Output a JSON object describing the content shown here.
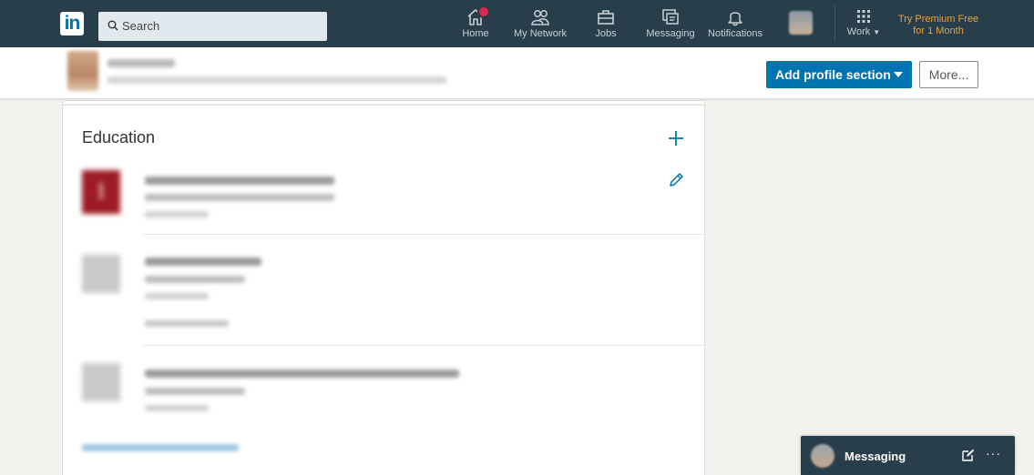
{
  "topbar": {
    "logo_text": "in",
    "search_placeholder": "Search",
    "nav": [
      {
        "label": "Home",
        "icon": "home-icon",
        "has_badge": true
      },
      {
        "label": "My Network",
        "icon": "network-icon"
      },
      {
        "label": "Jobs",
        "icon": "briefcase-icon"
      },
      {
        "label": "Messaging",
        "icon": "messaging-icon"
      },
      {
        "label": "Notifications",
        "icon": "bell-icon"
      }
    ],
    "work_label": "Work",
    "premium_line1": "Try Premium Free",
    "premium_line2": "for 1 Month"
  },
  "profile_bar": {
    "add_section_label": "Add profile section",
    "more_label": "More..."
  },
  "education": {
    "title": "Education"
  },
  "messaging_bar": {
    "label": "Messaging",
    "more_label": "···"
  },
  "colors": {
    "nav_bg": "#283e4a",
    "primary_blue": "#0073b1",
    "premium_gold": "#e7a33e",
    "badge_red": "#e0284f",
    "school_logo_red": "#9e1b25"
  }
}
